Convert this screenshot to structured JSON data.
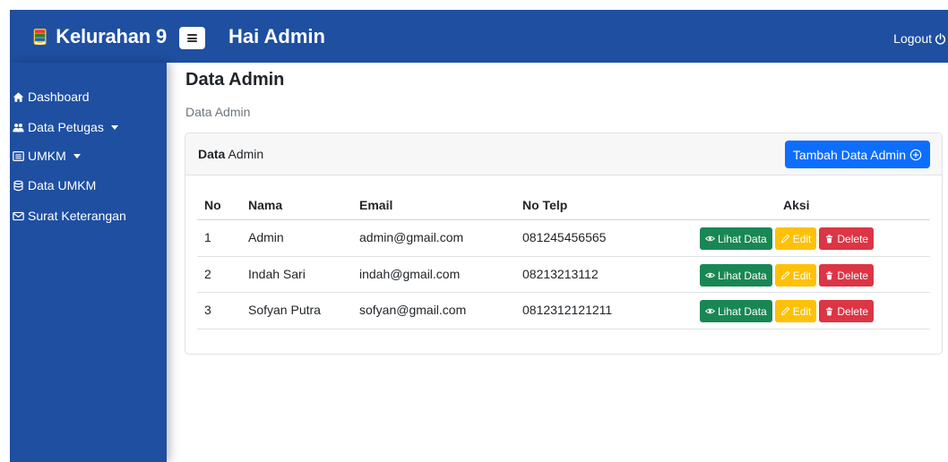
{
  "header": {
    "brand": "Kelurahan 9",
    "greeting": "Hai Admin",
    "logout_label": "Logout"
  },
  "sidebar": {
    "items": [
      {
        "label": "Dashboard",
        "icon": "home-icon"
      },
      {
        "label": "Data Petugas",
        "icon": "users-icon",
        "has_dropdown": true
      },
      {
        "label": "UMKM",
        "icon": "list-icon",
        "has_dropdown": true
      },
      {
        "label": "Data UMKM",
        "icon": "database-icon"
      },
      {
        "label": "Surat Keterangan",
        "icon": "envelope-icon"
      }
    ]
  },
  "page": {
    "title": "Data Admin",
    "breadcrumb": "Data Admin"
  },
  "card": {
    "title_bold": "Data",
    "title_rest": " Admin",
    "add_button": "Tambah Data Admin"
  },
  "table": {
    "columns": [
      "No",
      "Nama",
      "Email",
      "No Telp",
      "Aksi"
    ],
    "rows": [
      {
        "no": "1",
        "nama": "Admin",
        "email": "admin@gmail.com",
        "telp": "081245456565"
      },
      {
        "no": "2",
        "nama": "Indah Sari",
        "email": "indah@gmail.com",
        "telp": "08213213112"
      },
      {
        "no": "3",
        "nama": "Sofyan Putra",
        "email": "sofyan@gmail.com",
        "telp": "0812312121211"
      }
    ],
    "actions": {
      "view": "Lihat Data",
      "edit": "Edit",
      "delete": "Delete"
    }
  },
  "colors": {
    "primary_nav": "#1e4fa1",
    "button_primary": "#0d6efd",
    "button_success": "#198754",
    "button_warning": "#ffc107",
    "button_danger": "#dc3545"
  }
}
